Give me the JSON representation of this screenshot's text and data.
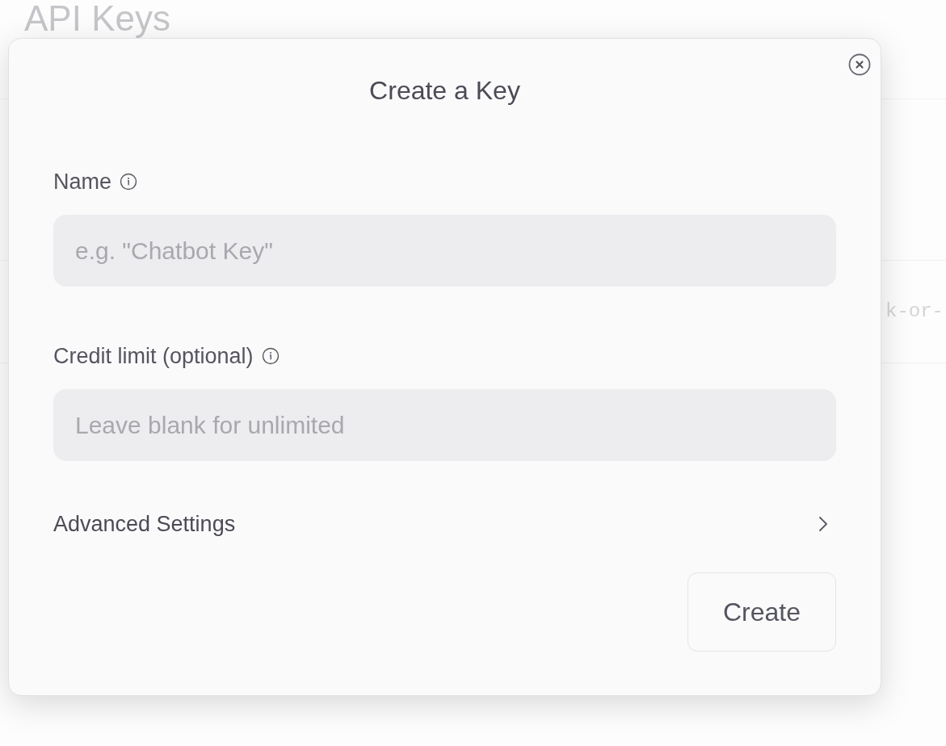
{
  "page": {
    "title": "API Keys",
    "row_text": "k-or-"
  },
  "dialog": {
    "title": "Create a Key",
    "fields": [
      {
        "label": "Name",
        "placeholder": "e.g. \"Chatbot Key\""
      },
      {
        "label": "Credit limit (optional)",
        "placeholder": "Leave blank for unlimited"
      }
    ],
    "advanced": {
      "label": "Advanced Settings",
      "expanded": false
    },
    "button": "Create"
  }
}
